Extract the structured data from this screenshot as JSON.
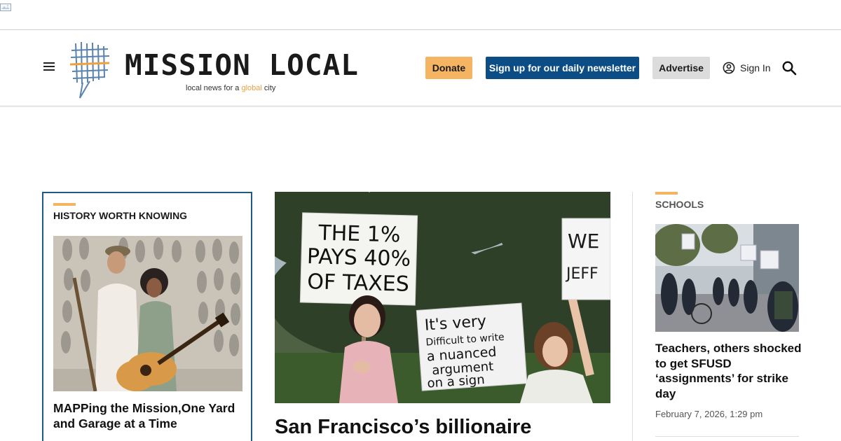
{
  "brand": {
    "name": "MISSION LOCAL",
    "tagline_start": "local news for a ",
    "tagline_accent": "global",
    "tagline_end": " city",
    "accent_color": "#f4b462",
    "navy_color": "#0d4d86"
  },
  "header": {
    "donate_label": "Donate",
    "newsletter_label": "Sign up for our daily newsletter",
    "advertise_label": "Advertise",
    "signin_label": "Sign In"
  },
  "left_story": {
    "kicker": "HISTORY WORTH KNOWING",
    "headline": "MAPPing the Mission,One Yard and Garage at a Time"
  },
  "center_story": {
    "headline": "San Francisco’s billionaire",
    "signs": {
      "sign1_line1": "THE 1%",
      "sign1_line2": "PAYS 40%",
      "sign1_line3": "OF TAXES",
      "sign2_line1": "It's very",
      "sign2_line2": "Difficult to write",
      "sign2_line3": "a nuanced",
      "sign2_line4": "argument",
      "sign2_line5": "on a sign",
      "sign3_line1": "WE",
      "sign3_line2": "JEFF"
    }
  },
  "right_story": {
    "kicker": "SCHOOLS",
    "headline": "Teachers, others shocked to get SFUSD ‘assignments’ for strike day",
    "date": "February 7, 2026, 1:29 pm"
  },
  "icons": {
    "menu": "hamburger-menu-icon",
    "user": "user-circle-icon",
    "search": "search-icon",
    "broken_image": "broken-image-icon"
  }
}
